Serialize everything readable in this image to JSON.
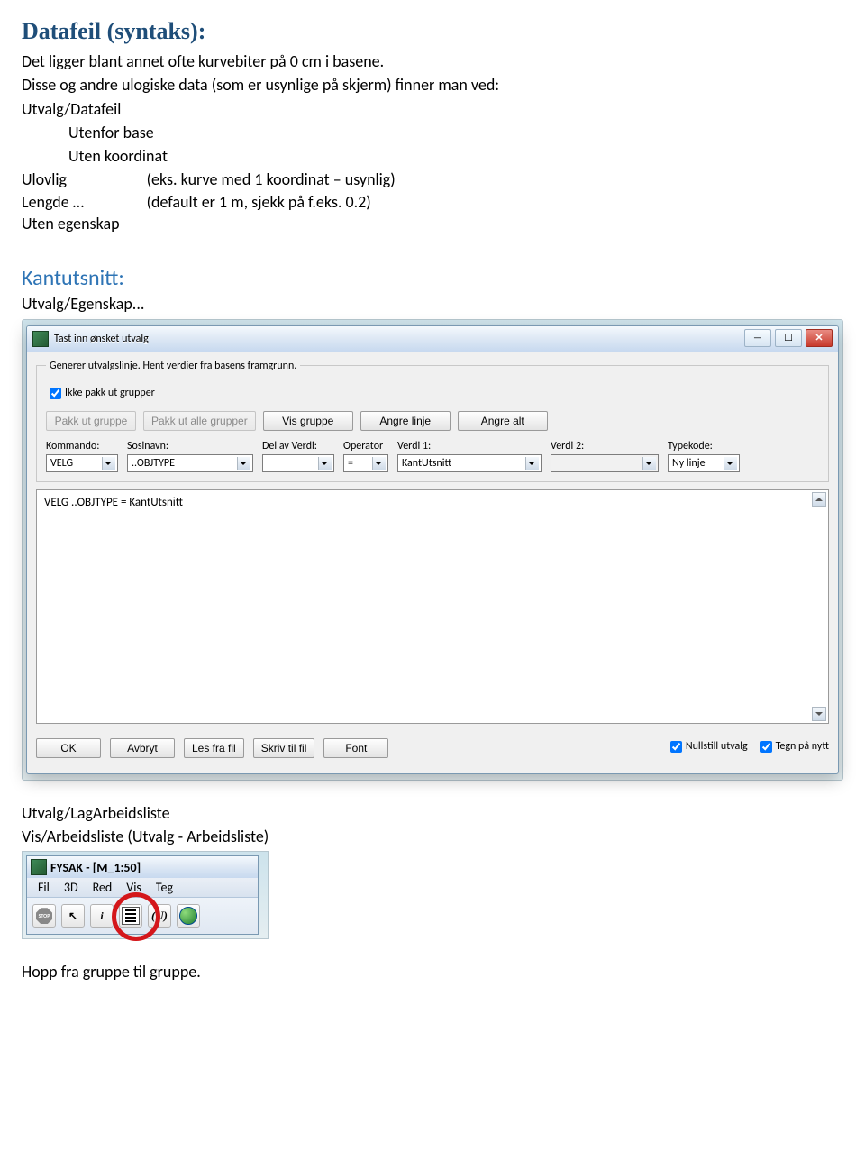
{
  "headings": {
    "datafeil": "Datafeil (syntaks):",
    "kantutsnitt": "Kantutsnitt:"
  },
  "intro": {
    "line1": "Det ligger blant annet ofte kurvebiter på 0 cm i basene.",
    "line2": "Disse og andre ulogiske data (som er usynlige på skjerm) finner man ved:",
    "line3": "Utvalg/Datafeil",
    "line4": "Utenfor base",
    "line5": "Uten koordinat",
    "table": {
      "ulovlig_l": "Ulovlig",
      "ulovlig_r": "(eks. kurve med 1 koordinat – usynlig)",
      "lengde_l": "Lengde …",
      "lengde_r": "(default er 1 m, sjekk på f.eks. 0.2)",
      "egenskap_l": "Uten egenskap",
      "egenskap_r": ""
    }
  },
  "kant_line": "Utvalg/Egenskap...",
  "dialog": {
    "title": "Tast inn ønsket utvalg",
    "groupbox_legend": "Generer utvalgslinje. Hent verdier fra basens framgrunn.",
    "ikke_pakk": "Ikke pakk ut grupper",
    "btn_pakk_ut_gruppe": "Pakk ut gruppe",
    "btn_pakk_ut_alle": "Pakk ut alle grupper",
    "btn_vis_gruppe": "Vis gruppe",
    "btn_angre_linje": "Angre linje",
    "btn_angre_alt": "Angre alt",
    "labels": {
      "kommando": "Kommando:",
      "sosinavn": "Sosinavn:",
      "del_av_verdi": "Del av Verdi:",
      "operator": "Operator",
      "verdi1": "Verdi 1:",
      "verdi2": "Verdi 2:",
      "typekode": "Typekode:"
    },
    "values": {
      "kommando": "VELG",
      "sosinavn": "..OBJTYPE",
      "del_av_verdi": "",
      "operator": "=",
      "verdi1": "KantUtsnitt",
      "verdi2": "",
      "typekode": "Ny linje"
    },
    "textarea": "VELG ..OBJTYPE = KantUtsnitt",
    "bottom": {
      "ok": "OK",
      "avbryt": "Avbryt",
      "les": "Les fra fil",
      "skriv": "Skriv til fil",
      "font": "Font",
      "nullstill": "Nullstill utvalg",
      "tegn": "Tegn på nytt"
    }
  },
  "post_dialog": {
    "l1": "Utvalg/LagArbeidsliste",
    "l2": "Vis/Arbeidsliste (Utvalg - Arbeidsliste)"
  },
  "fysak": {
    "title": "FYSAK - [M_1:50]",
    "menus": [
      "Fil",
      "3D",
      "Red",
      "Vis",
      "Teg"
    ],
    "tools": {
      "stop": "STOP",
      "arrow": "arrow",
      "info": "i",
      "list": "list",
      "u": "(U)",
      "globe": "globe"
    }
  },
  "last": "Hopp fra gruppe til gruppe."
}
